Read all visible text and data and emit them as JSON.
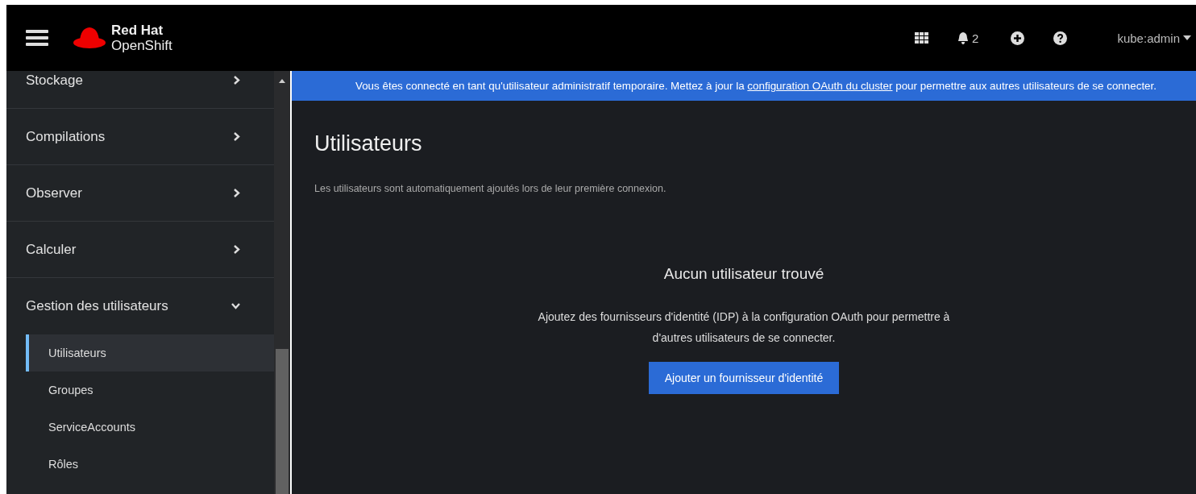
{
  "masthead": {
    "logo_line_1": "Red Hat",
    "logo_line_2": "OpenShift",
    "notification_count": "2",
    "user": "kube:admin"
  },
  "sidebar": {
    "sections": [
      {
        "label": "Stockage",
        "expanded": false
      },
      {
        "label": "Compilations",
        "expanded": false
      },
      {
        "label": "Observer",
        "expanded": false
      },
      {
        "label": "Calculer",
        "expanded": false
      },
      {
        "label": "Gestion des utilisateurs",
        "expanded": true,
        "children": [
          {
            "label": "Utilisateurs",
            "selected": true
          },
          {
            "label": "Groupes",
            "selected": false
          },
          {
            "label": "ServiceAccounts",
            "selected": false
          },
          {
            "label": "Rôles",
            "selected": false
          }
        ]
      }
    ]
  },
  "banner": {
    "text_before": "Vous êtes connecté en tant qu'utilisateur administratif temporaire. Mettez à jour la",
    "link": "configuration OAuth du cluster",
    "text_after": "pour permettre aux autres utilisateurs de se connecter."
  },
  "page": {
    "title": "Utilisateurs",
    "description": "Les utilisateurs sont automatiquement ajoutés lors de leur première connexion.",
    "empty_state": {
      "title": "Aucun utilisateur trouvé",
      "body": "Ajoutez des fournisseurs d'identité (IDP) à la configuration OAuth pour permettre à d'autres utilisateurs de se connecter.",
      "button": "Ajouter un fournisseur d'identité"
    }
  }
}
